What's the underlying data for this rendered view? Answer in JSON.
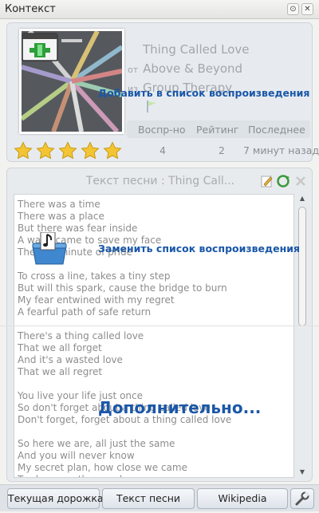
{
  "window": {
    "title": "Контекст",
    "buttons": {
      "float": "⊙",
      "close": "✕"
    }
  },
  "current_track": {
    "title": "Thing Called Love",
    "artist_prefix": "от",
    "artist": "Above & Beyond",
    "album_prefix": "из",
    "album": "Group Therapy",
    "cover_icon": "image-icon",
    "add_to_playlist_label": "Добавить в список воспроизведения",
    "rating_stars": 5,
    "stats": {
      "headers": [
        "Воспр-но",
        "Рейтинг",
        "Последнее"
      ],
      "values": [
        "4",
        "2",
        "7 минут назад"
      ]
    },
    "colors": {
      "star": "#f3c534",
      "overlay_text": "#1a57a8"
    }
  },
  "lyrics": {
    "title": "Текст песни : Thing Call...",
    "toolbar_icons": [
      "edit-icon",
      "refresh-icon",
      "close-icon"
    ],
    "replace_playlist_label": "Заменить список воспроизведения",
    "more_label": "Дополнительно...",
    "text": "There was a time\nThere was a place\nBut there was fear inside\nA wave came to save my face\nThe last minute of pride\n\nTo cross a line, takes a tiny step\nBut will this spark, cause the bridge to burn\nMy fear entwined with my regret\nA fearful path of safe return\n\nThere's a thing called love\nThat we all forget\nAnd it's a wasted love\nThat we all regret\n\nYou live your life just once\nSo don't forget about a thing called love\nDon't forget, forget about a thing called love\n\nSo here we are, all just the same\nAnd you will never know\nMy secret plan, how close we came\nTo share another road"
  },
  "tabs": [
    {
      "label": "Текущая дорожка"
    },
    {
      "label": "Текст песни"
    },
    {
      "label": "Wikipedia"
    },
    {
      "icon": "wrench-icon"
    }
  ]
}
